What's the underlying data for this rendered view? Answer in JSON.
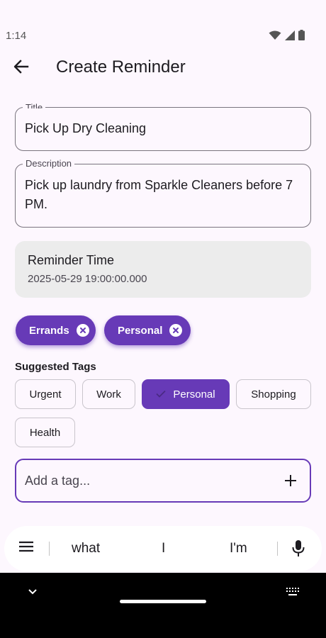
{
  "status": {
    "time": "1:14"
  },
  "app_bar": {
    "title": "Create Reminder"
  },
  "form": {
    "title_label": "Title",
    "title_value": "Pick Up Dry Cleaning",
    "description_label": "Description",
    "description_value": "Pick up laundry from Sparkle Cleaners before 7 PM.",
    "reminder_time_label": "Reminder Time",
    "reminder_time_value": "2025-05-29 19:00:00.000"
  },
  "selected_tags": [
    "Errands",
    "Personal"
  ],
  "suggested_tags": {
    "label": "Suggested Tags",
    "items": [
      "Urgent",
      "Work",
      "Personal",
      "Shopping",
      "Health"
    ],
    "active": "Personal"
  },
  "tag_input": {
    "placeholder": "Add a tag..."
  },
  "keyboard": {
    "suggestions": [
      "what",
      "I",
      "I'm"
    ]
  },
  "colors": {
    "primary": "#673ab7",
    "background": "#fdf7fe",
    "card": "#ececec"
  }
}
